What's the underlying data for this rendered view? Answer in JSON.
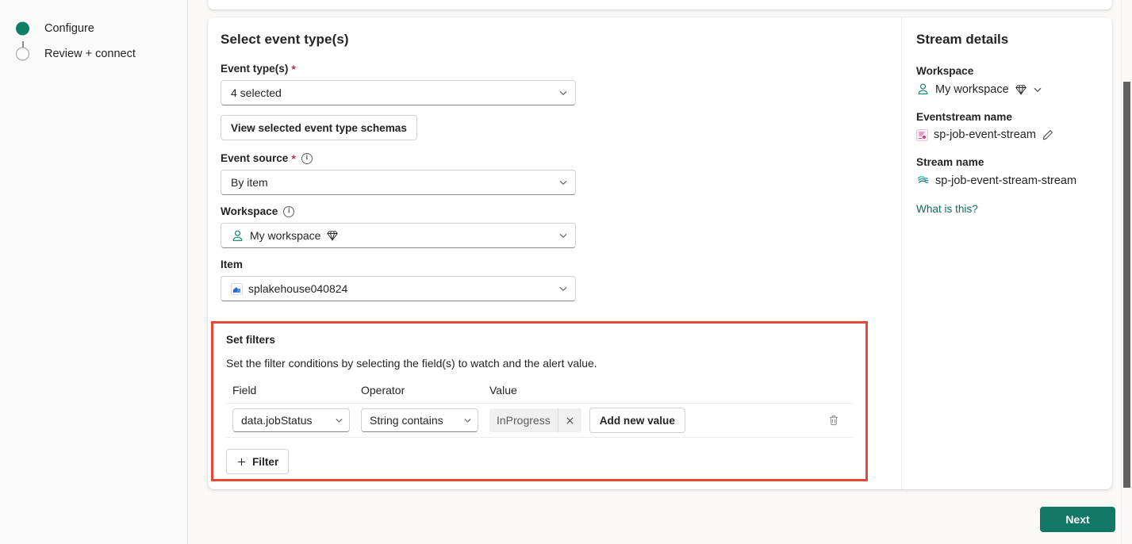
{
  "wizard": {
    "steps": [
      {
        "label": "Configure",
        "state": "done"
      },
      {
        "label": "Review + connect",
        "state": "todo"
      }
    ]
  },
  "form": {
    "section_title": "Select event type(s)",
    "event_types": {
      "label": "Event type(s)",
      "required": "*",
      "value": "4 selected"
    },
    "view_schemas_button": "View selected event type schemas",
    "event_source": {
      "label": "Event source",
      "required": "*",
      "value": "By item"
    },
    "workspace": {
      "label": "Workspace",
      "value": "My workspace"
    },
    "item": {
      "label": "Item",
      "value": "splakehouse040824"
    }
  },
  "filters": {
    "title": "Set filters",
    "description": "Set the filter conditions by selecting the field(s) to watch and the alert value.",
    "columns": [
      "Field",
      "Operator",
      "Value"
    ],
    "rows": [
      {
        "field": "data.jobStatus",
        "operator": "String contains",
        "value_chip": "InProgress",
        "add_value_label": "Add new value"
      }
    ],
    "add_filter_label": "Filter",
    "highlight_color": "#e8483c"
  },
  "stream_details": {
    "title": "Stream details",
    "workspace_label": "Workspace",
    "workspace_value": "My workspace",
    "eventstream_label": "Eventstream name",
    "eventstream_value": "sp-job-event-stream",
    "stream_label": "Stream name",
    "stream_value": "sp-job-event-stream-stream",
    "help_link": "What is this?"
  },
  "footer": {
    "next_label": "Next"
  },
  "theme": {
    "accent": "#117865",
    "link": "#0f6e5c",
    "required_star": "#c4314b",
    "highlight": "#e8483c"
  }
}
